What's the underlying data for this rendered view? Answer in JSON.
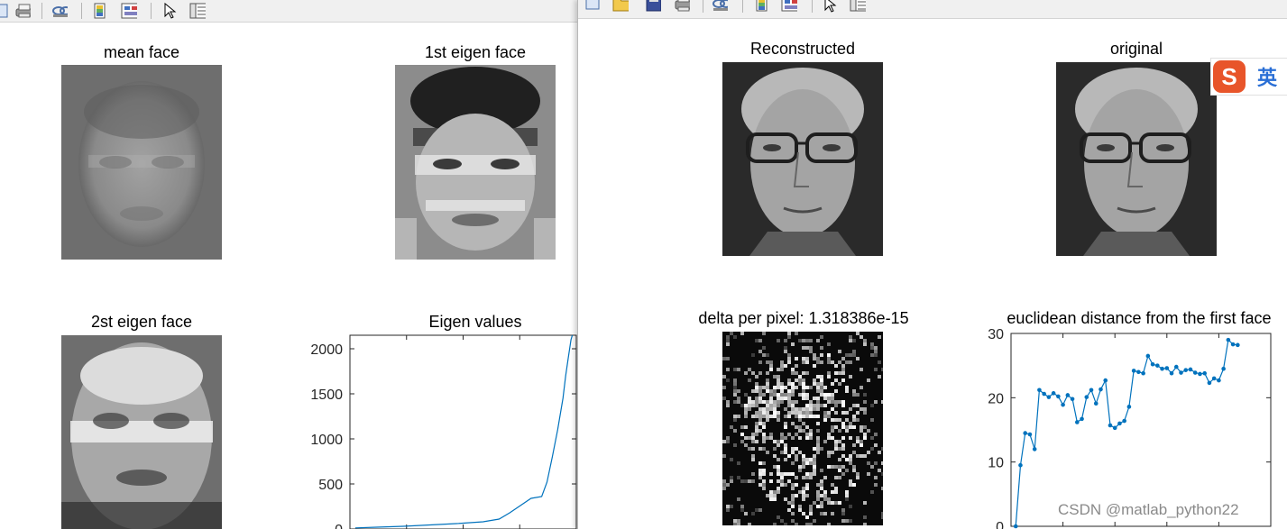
{
  "left_window": {
    "toolbar_icons": [
      "new-figure-icon",
      "print-icon",
      "link-icon",
      "colorbar-icon",
      "legend-icon",
      "pointer-icon",
      "property-inspector-icon"
    ],
    "panels": [
      {
        "title": "mean face",
        "image": "grayscale-face-image"
      },
      {
        "title": "1st eigen face",
        "image": "grayscale-face-image"
      },
      {
        "title": "2st eigen face",
        "image": "grayscale-face-image"
      }
    ]
  },
  "right_window": {
    "toolbar_icons": [
      "new-figure-icon",
      "open-icon",
      "save-icon",
      "print-icon",
      "link-icon",
      "colorbar-icon",
      "legend-icon",
      "pointer-icon",
      "property-inspector-icon"
    ],
    "panels": [
      {
        "title": "Reconstructed",
        "image": "grayscale-face-photo"
      },
      {
        "title": "original",
        "image": "grayscale-face-photo"
      },
      {
        "title": "delta per pixel: 1.318386e-15",
        "image": "difference-noise-image"
      }
    ]
  },
  "chart_data": [
    {
      "type": "line",
      "title": "Eigen values",
      "xlabel": "",
      "ylabel": "",
      "ylim": [
        0,
        2150
      ],
      "yticks": [
        0,
        500,
        1000,
        1500,
        2000
      ],
      "x": [
        1,
        5,
        10,
        15,
        20,
        25,
        28,
        30,
        32,
        34,
        36,
        37,
        38,
        39,
        40,
        40.5,
        41,
        41.5,
        42
      ],
      "values": [
        12,
        20,
        30,
        45,
        60,
        80,
        110,
        180,
        260,
        340,
        360,
        520,
        800,
        1100,
        1450,
        1700,
        1900,
        2100,
        2200
      ],
      "color": "#0072bd",
      "grid": false
    },
    {
      "type": "line",
      "title": "euclidean distance from the first face",
      "xlabel": "",
      "ylabel": "",
      "ylim": [
        0,
        30
      ],
      "yticks": [
        0,
        10,
        20,
        30
      ],
      "x": [
        1,
        2,
        3,
        4,
        5,
        6,
        7,
        8,
        9,
        10,
        11,
        12,
        13,
        14,
        15,
        16,
        17,
        18,
        19,
        20,
        21,
        22,
        23,
        24,
        25,
        26,
        27,
        28,
        29,
        30,
        31,
        32,
        33,
        34,
        35,
        36,
        37,
        38,
        39,
        40,
        41,
        42,
        43,
        44,
        45,
        46,
        47,
        48
      ],
      "values": [
        0,
        9.5,
        14.5,
        14.3,
        12,
        21.2,
        20.6,
        20.1,
        20.7,
        20.2,
        18.9,
        20.4,
        19.8,
        16.2,
        16.7,
        20.1,
        21.2,
        19.1,
        21.3,
        22.7,
        15.7,
        15.3,
        16.0,
        16.4,
        18.6,
        24.2,
        24.0,
        23.8,
        26.5,
        25.2,
        25.0,
        24.5,
        24.6,
        23.8,
        24.8,
        23.9,
        24.3,
        24.4,
        23.9,
        23.7,
        23.8,
        22.3,
        23.0,
        22.7,
        24.5,
        29.0,
        28.3,
        28.2
      ],
      "color": "#0072bd",
      "grid": false
    }
  ],
  "overlay": {
    "ime_logo": "S",
    "ime_label": "英",
    "watermark": "CSDN @matlab_python22"
  }
}
